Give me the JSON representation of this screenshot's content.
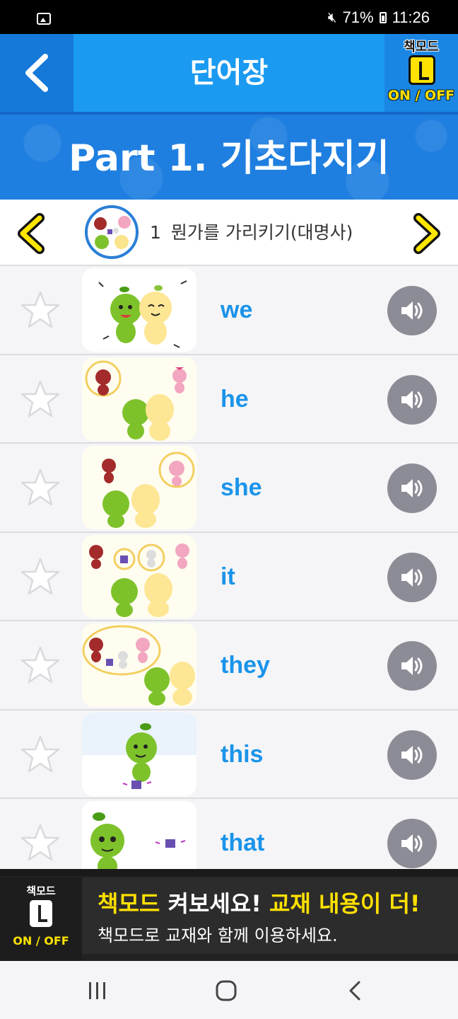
{
  "status_bar": {
    "battery": "71%",
    "time": "11:26",
    "icons": [
      "gallery-icon",
      "mute-icon",
      "battery-icon"
    ]
  },
  "header": {
    "title": "단어장",
    "back_icon": "chevron-left-icon",
    "book_mode_label": "책모드",
    "book_mode_toggle": "ON / OFF"
  },
  "banner": {
    "title": "Part 1. 기초다지기"
  },
  "chapter": {
    "number": "1",
    "title": "뭔가를 가리키기(대명사)",
    "prev_icon": "yellow-chevron-left-icon",
    "next_icon": "yellow-chevron-right-icon"
  },
  "words": [
    {
      "word": "we"
    },
    {
      "word": "he"
    },
    {
      "word": "she"
    },
    {
      "word": "it"
    },
    {
      "word": "they"
    },
    {
      "word": "this"
    },
    {
      "word": "that"
    }
  ],
  "ad": {
    "logo_label": "책모드",
    "logo_toggle": "ON / OFF",
    "headline_part1": "책모드",
    "headline_part2": " 켜보세요! ",
    "headline_part3": "교재 내용이 더!",
    "subtext": "책모드로 교재와 함께 이용하세요."
  },
  "colors": {
    "accent": "#1a9af0",
    "word_text": "#1a94ea",
    "ad_highlight": "#ffe000"
  }
}
